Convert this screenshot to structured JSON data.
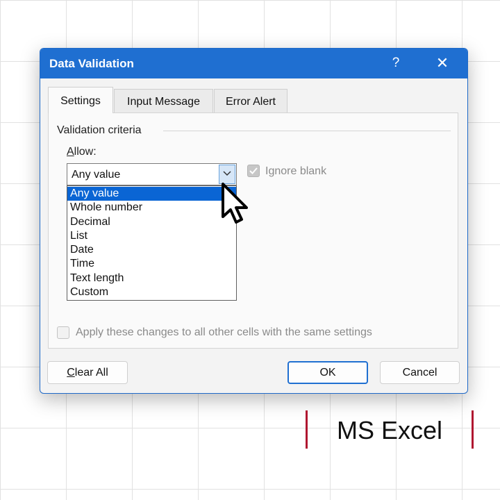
{
  "dialog": {
    "title": "Data Validation",
    "help_label": "?",
    "close_label": "✕",
    "tabs": [
      "Settings",
      "Input Message",
      "Error Alert"
    ],
    "active_tab": "Settings",
    "section_label": "Validation criteria",
    "allow_label_rest": "llow:",
    "allow_label_accel": "A",
    "allow_value": "Any value",
    "allow_options": [
      "Any value",
      "Whole number",
      "Decimal",
      "List",
      "Date",
      "Time",
      "Text length",
      "Custom"
    ],
    "selected_option": "Any value",
    "ignore_blank_label": "Ignore blank",
    "ignore_blank_checked": true,
    "apply_label": "Apply these changes to all other cells with the same settings",
    "apply_checked": false,
    "clear_all_accel": "C",
    "clear_all_rest": "lear All",
    "ok_label": "OK",
    "cancel_label": "Cancel"
  },
  "brand": {
    "text": "MS Excel",
    "accent_color": "#b01630"
  },
  "colors": {
    "titlebar": "#1f6fd1",
    "selection": "#0a65d4"
  }
}
